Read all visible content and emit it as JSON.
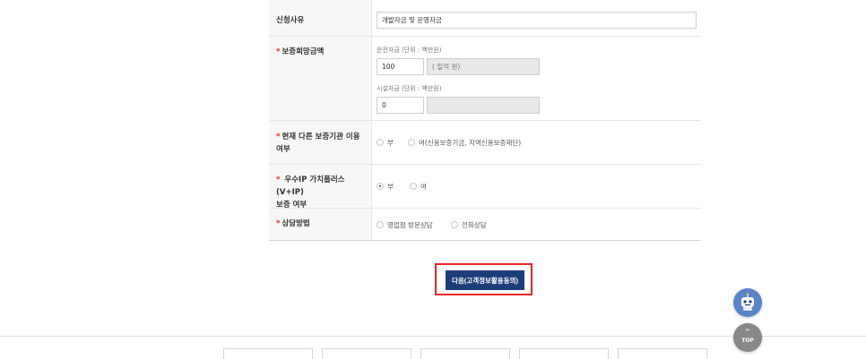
{
  "form": {
    "reason": {
      "label": "신청사유",
      "value": "개발자금 및 운영자금"
    },
    "amount": {
      "required_mark": "*",
      "label": "보증희망금액",
      "operating_caption": "운전자금 (단위 : 백만원)",
      "operating_value": "100",
      "operating_readout": "( 일억 원)",
      "facility_caption": "시설자금 (단위 : 백만원)",
      "facility_value": "0",
      "facility_readout": ""
    },
    "other_guarantee": {
      "required_mark": "*",
      "label_line1": "현재 다른 보증기관 이용",
      "label_line2": "여부",
      "options": [
        {
          "label": "부",
          "checked": false
        },
        {
          "label": "여(신용보증기금, 지역신용보증재단)",
          "checked": false
        }
      ]
    },
    "vip": {
      "required_mark": "*",
      "label_line1": " 우수IP 가치플러스(V+IP)",
      "label_line2": "보증 여부",
      "options": [
        {
          "label": "부",
          "checked": true
        },
        {
          "label": "여",
          "checked": false
        }
      ]
    },
    "consult": {
      "required_mark": "*",
      "label": "상담방법",
      "options": [
        {
          "label": "영업점 방문상담",
          "checked": false
        },
        {
          "label": "전화상담",
          "checked": false
        }
      ]
    }
  },
  "actions": {
    "next_label": "다음(고객정보활용동의)"
  },
  "floating": {
    "chatbot_icon": "chatbot-robot-icon",
    "top_arrow": "^",
    "top_label": "TOP"
  },
  "colors": {
    "primary": "#1d3c7a",
    "highlight": "#e8262a",
    "required": "#d9301c"
  }
}
